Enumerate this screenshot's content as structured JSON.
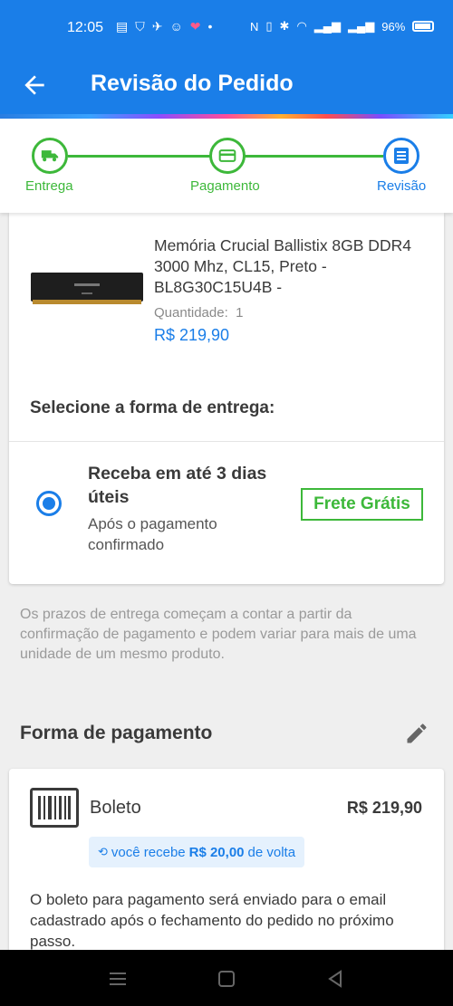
{
  "status_bar": {
    "time": "12:05",
    "battery": "96%"
  },
  "app_bar": {
    "title": "Revisão do Pedido"
  },
  "stepper": {
    "steps": [
      {
        "label": "Entrega",
        "icon": "truck-icon"
      },
      {
        "label": "Pagamento",
        "icon": "card-icon"
      },
      {
        "label": "Revisão",
        "icon": "document-icon"
      }
    ]
  },
  "product": {
    "name": "Memória Crucial Ballistix 8GB DDR4 3000 Mhz, CL15, Preto - BL8G30C15U4B -",
    "quantity_label": "Quantidade:",
    "quantity": "1",
    "price": "R$ 219,90"
  },
  "shipping": {
    "title": "Selecione a forma de entrega:",
    "option_title": "Receba em até 3 dias úteis",
    "option_subtitle": "Após o pagamento confirmado",
    "badge": "Frete Grátis",
    "note": "Os prazos de entrega começam a contar a partir da confirmação de pagamento e podem variar para mais de uma unidade de um mesmo produto."
  },
  "payment": {
    "title": "Forma de pagamento",
    "method": "Boleto",
    "price": "R$ 219,90",
    "cashback_prefix": "você recebe",
    "cashback_amount": "R$ 20,00",
    "cashback_suffix": "de volta",
    "description": "O boleto para pagamento será enviado para o email cadastrado após o fechamento do pedido no próximo passo."
  },
  "colors": {
    "primary": "#1a7ee8",
    "success": "#3db83a"
  }
}
